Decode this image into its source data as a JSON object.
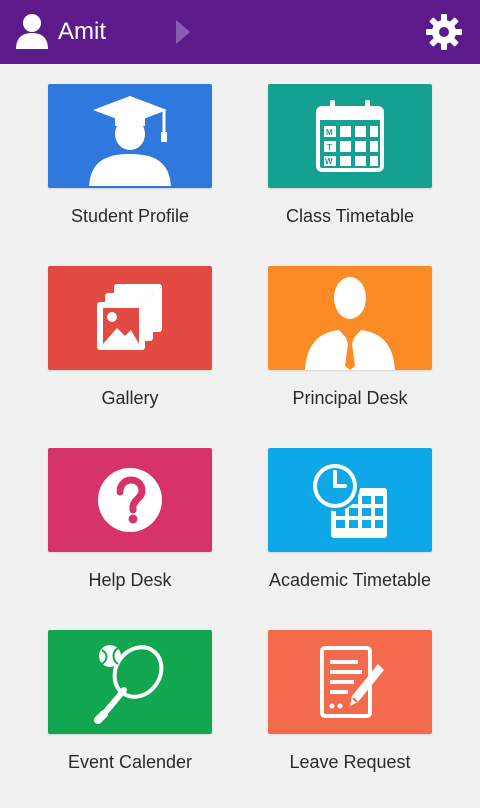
{
  "header": {
    "user_name": "Amit",
    "color": "#5c1a8a"
  },
  "tiles": [
    {
      "label": "Student Profile",
      "icon": "student-graduate-icon",
      "color": "#2e78de"
    },
    {
      "label": "Class Timetable",
      "icon": "calendar-icon",
      "color": "#15a192"
    },
    {
      "label": "Gallery",
      "icon": "gallery-icon",
      "color": "#e34a41"
    },
    {
      "label": "Principal Desk",
      "icon": "principal-icon",
      "color": "#fb8c25"
    },
    {
      "label": "Help Desk",
      "icon": "question-icon",
      "color": "#d6336b"
    },
    {
      "label": "Academic Timetable",
      "icon": "clock-calendar-icon",
      "color": "#0ea8e8"
    },
    {
      "label": "Event Calender",
      "icon": "tennis-racket-icon",
      "color": "#12a650"
    },
    {
      "label": "Leave Request",
      "icon": "leave-form-icon",
      "color": "#f36a4d"
    }
  ]
}
